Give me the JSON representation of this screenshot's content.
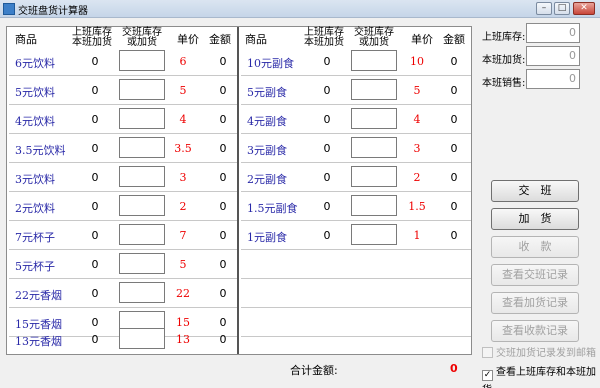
{
  "window": {
    "title": "交班盘货计算器",
    "btn_min": "–",
    "btn_max": "□",
    "btn_close": "✕"
  },
  "table": {
    "headers": {
      "name": "商品",
      "stock_line1": "上班库存",
      "stock_line2": "本班加货",
      "input_line1": "交班库存",
      "input_line2": "或加货",
      "price": "单价",
      "amount": "金额"
    },
    "left_rows": [
      {
        "name": "6元饮料",
        "stock": "0",
        "price": "6",
        "amount": "0"
      },
      {
        "name": "5元饮料",
        "stock": "0",
        "price": "5",
        "amount": "0"
      },
      {
        "name": "4元饮料",
        "stock": "0",
        "price": "4",
        "amount": "0"
      },
      {
        "name": "3.5元饮料",
        "stock": "0",
        "price": "3.5",
        "amount": "0"
      },
      {
        "name": "3元饮料",
        "stock": "0",
        "price": "3",
        "amount": "0"
      },
      {
        "name": "2元饮料",
        "stock": "0",
        "price": "2",
        "amount": "0"
      },
      {
        "name": "7元杯子",
        "stock": "0",
        "price": "7",
        "amount": "0"
      },
      {
        "name": "5元杯子",
        "stock": "0",
        "price": "5",
        "amount": "0"
      },
      {
        "name": "22元香烟",
        "stock": "0",
        "price": "22",
        "amount": "0"
      },
      {
        "name": "15元香烟",
        "stock": "0",
        "price": "15",
        "amount": "0"
      },
      {
        "name": "13元香烟",
        "stock": "0",
        "price": "13",
        "amount": "0"
      }
    ],
    "right_rows": [
      {
        "name": "10元副食",
        "stock": "0",
        "price": "10",
        "amount": "0"
      },
      {
        "name": "5元副食",
        "stock": "0",
        "price": "5",
        "amount": "0"
      },
      {
        "name": "4元副食",
        "stock": "0",
        "price": "4",
        "amount": "0"
      },
      {
        "name": "3元副食",
        "stock": "0",
        "price": "3",
        "amount": "0"
      },
      {
        "name": "2元副食",
        "stock": "0",
        "price": "2",
        "amount": "0"
      },
      {
        "name": "1.5元副食",
        "stock": "0",
        "price": "1.5",
        "amount": "0"
      },
      {
        "name": "1元副食",
        "stock": "0",
        "price": "1",
        "amount": "0"
      }
    ]
  },
  "total": {
    "label": "合计金额:",
    "value": "0"
  },
  "side": {
    "last_stock_label": "上班库存:",
    "last_stock_value": "0",
    "restock_label": "本班加货:",
    "restock_value": "0",
    "sales_label": "本班销售:",
    "sales_value": "0"
  },
  "buttons": {
    "shift": "交　班",
    "restock": "加　货",
    "collect": "收　款",
    "view_shift": "查看交班记录",
    "view_restock": "查看加货记录",
    "view_collect": "查看收款记录"
  },
  "checks": {
    "email": "交班加货记录发到邮箱",
    "show_stock": "查看上班库存和本班加货",
    "check_mark": "✓"
  }
}
